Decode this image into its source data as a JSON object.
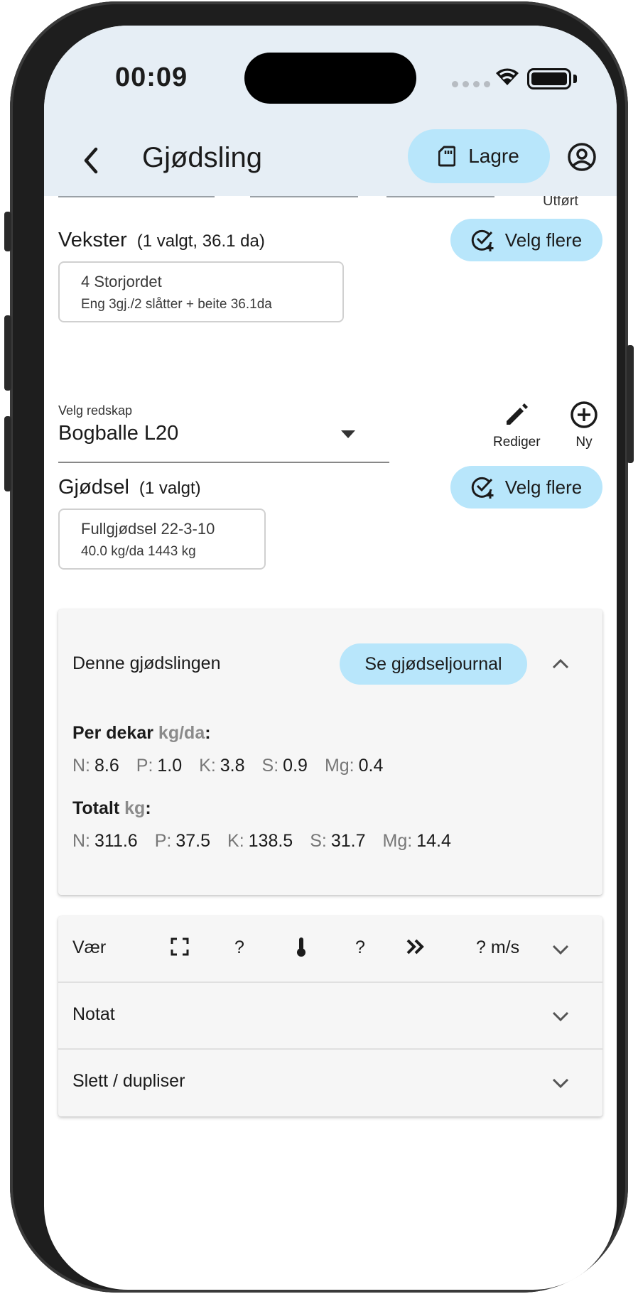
{
  "status": {
    "time": "00:09"
  },
  "header": {
    "back_icon": "chevron-left-icon",
    "title": "Gjødsling",
    "save_label": "Lagre",
    "account_icon": "account-circle-icon"
  },
  "partial_top": {
    "label": "Utført"
  },
  "vekster": {
    "title": "Vekster",
    "subtitle": "(1 valgt, 36.1 da)",
    "select_more": "Velg flere",
    "chip": {
      "line1": "4 Storjordet",
      "line2": "Eng 3gj./2 slåtter + beite  36.1da"
    }
  },
  "redskap": {
    "label": "Velg redskap",
    "value": "Bogballe L20",
    "edit_label": "Rediger",
    "new_label": "Ny"
  },
  "gjodsel": {
    "title": "Gjødsel",
    "subtitle": "(1 valgt)",
    "select_more": "Velg flere",
    "chip": {
      "line1": "Fullgjødsel 22-3-10",
      "line2": "40.0 kg/da 1443 kg"
    }
  },
  "summary": {
    "title": "Denne gjødslingen",
    "journal_button": "Se gjødseljournal",
    "per_dekar": {
      "title": "Per dekar",
      "unit": "kg/da",
      "colon": ":"
    },
    "per_dekar_values": [
      {
        "k": "N:",
        "v": "8.6"
      },
      {
        "k": "P:",
        "v": "1.0"
      },
      {
        "k": "K:",
        "v": "3.8"
      },
      {
        "k": "S:",
        "v": "0.9"
      },
      {
        "k": "Mg:",
        "v": "0.4"
      }
    ],
    "totalt": {
      "title": "Totalt",
      "unit": "kg",
      "colon": ":"
    },
    "totalt_values": [
      {
        "k": "N:",
        "v": "311.6"
      },
      {
        "k": "P:",
        "v": "37.5"
      },
      {
        "k": "K:",
        "v": "138.5"
      },
      {
        "k": "S:",
        "v": "31.7"
      },
      {
        "k": "Mg:",
        "v": "14.4"
      }
    ]
  },
  "accordion": {
    "weather": {
      "label": "Vær",
      "cloud_value": "?",
      "temp_value": "?",
      "wind_value": "? m/s"
    },
    "note": {
      "label": "Notat"
    },
    "delete": {
      "label": "Slett / dupliser"
    }
  }
}
